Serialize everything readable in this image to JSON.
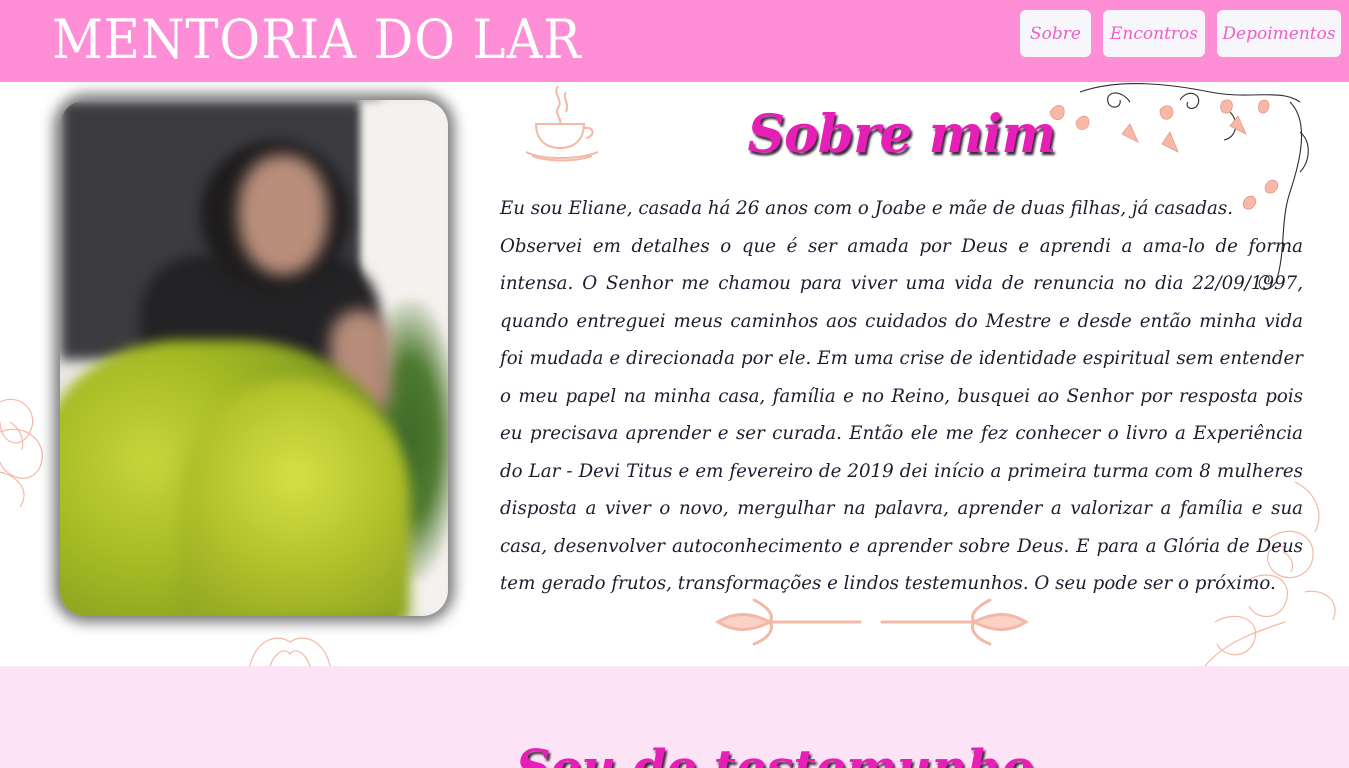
{
  "header": {
    "brand": "MENTORIA DO LAR",
    "nav": [
      {
        "label": "Sobre"
      },
      {
        "label": "Encontros"
      },
      {
        "label": "Depoimentos"
      }
    ]
  },
  "about": {
    "title": "Sobre mim",
    "lines": [
      "Eu sou Eliane, casada há 26 anos com o Joabe e mãe de duas filhas, já casadas.",
      "Observei em detalhes o que é ser amada por Deus e aprendi a ama-lo de forma intensa. O Senhor me chamou para viver uma vida de renuncia no dia 22/09/1997, quando entreguei meus caminhos aos cuidados do Mestre e desde então minha vida foi mudada e direcionada por ele. Em uma crise de identidade espiritual sem entender o meu papel na minha casa, família e no Reino, busquei ao Senhor por resposta pois eu precisava aprender e ser curada. Então ele me fez conhecer o livro a Experiência do Lar - Devi Titus e em fevereiro de 2019 dei início a primeira turma com 8 mulheres disposta a viver o novo, mergulhar na palavra, aprender a valorizar a família e sua casa, desenvolver autoconhecimento e aprender sobre Deus. E para a Glória de Deus tem gerado frutos, transformações e lindos testemunhos. O seu pode ser o próximo."
    ]
  },
  "next_section": {
    "title_partial": "Seu de testemunho"
  },
  "colors": {
    "header_bg": "#fe8fd6",
    "accent_pink": "#e61fb7",
    "nav_text": "#e863c7",
    "lower_bg": "#fde3f6",
    "floral_line": "#f4b8a6"
  },
  "icons": [
    "coffee-cup-icon",
    "floral-swirl-decoration",
    "arrow-divider-decoration",
    "flower-outline-decoration"
  ]
}
